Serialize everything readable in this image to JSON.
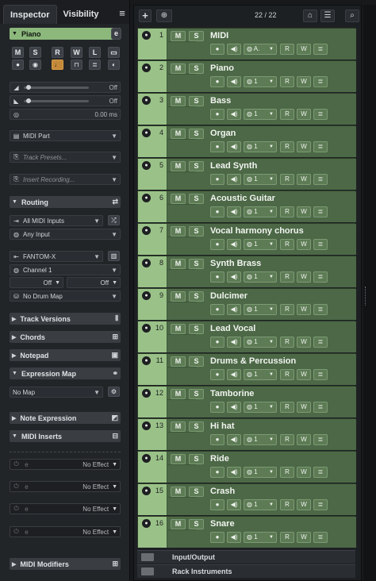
{
  "inspector": {
    "tabs": [
      "Inspector",
      "Visibility"
    ],
    "menu_icon": "≡",
    "track_name": "Piano",
    "edit_icon": "e",
    "buttons_row1": [
      "M",
      "S",
      "R",
      "W",
      "L"
    ],
    "volume": "Off",
    "pan": "Off",
    "delay": "0.00 ms",
    "midi_part": "MIDI Part",
    "track_presets": "Track Presets...",
    "insert_recording": "Insert Recording...",
    "routing_label": "Routing",
    "midi_input": "All MIDI Inputs",
    "input_mode": "Any Input",
    "output_device": "FANTOM-X",
    "channel": "Channel 1",
    "off_left": "Off",
    "off_right": "Off",
    "drum_map": "No Drum Map",
    "track_versions": "Track Versions",
    "chords": "Chords",
    "notepad": "Notepad",
    "expression_map": "Expression Map",
    "no_map": "No Map",
    "note_expression": "Note Expression",
    "midi_inserts": "MIDI Inserts",
    "inserts": [
      "No Effect",
      "No Effect",
      "No Effect",
      "No Effect"
    ],
    "midi_modifiers": "MIDI Modifiers"
  },
  "toolbar": {
    "add": "+",
    "counter": "22 / 22",
    "search_icon": "search-icon"
  },
  "tracks": [
    {
      "num": "1",
      "name": "MIDI",
      "first": true
    },
    {
      "num": "2",
      "name": "Piano"
    },
    {
      "num": "3",
      "name": "Bass"
    },
    {
      "num": "4",
      "name": "Organ"
    },
    {
      "num": "5",
      "name": "Lead Synth"
    },
    {
      "num": "6",
      "name": "Acoustic Guitar"
    },
    {
      "num": "7",
      "name": "Vocal harmony chorus"
    },
    {
      "num": "8",
      "name": "Synth Brass"
    },
    {
      "num": "9",
      "name": "Dulcimer"
    },
    {
      "num": "10",
      "name": "Lead Vocal"
    },
    {
      "num": "11",
      "name": "Drums & Percussion"
    },
    {
      "num": "12",
      "name": "Tamborine"
    },
    {
      "num": "13",
      "name": "Hi hat"
    },
    {
      "num": "14",
      "name": "Ride"
    },
    {
      "num": "15",
      "name": "Crash"
    },
    {
      "num": "16",
      "name": "Snare"
    }
  ],
  "track_controls": {
    "mute": "M",
    "solo": "S",
    "read": "R",
    "write": "W",
    "channel": "1",
    "channel_first": "A."
  },
  "folders": [
    "Input/Output",
    "Rack Instruments"
  ]
}
